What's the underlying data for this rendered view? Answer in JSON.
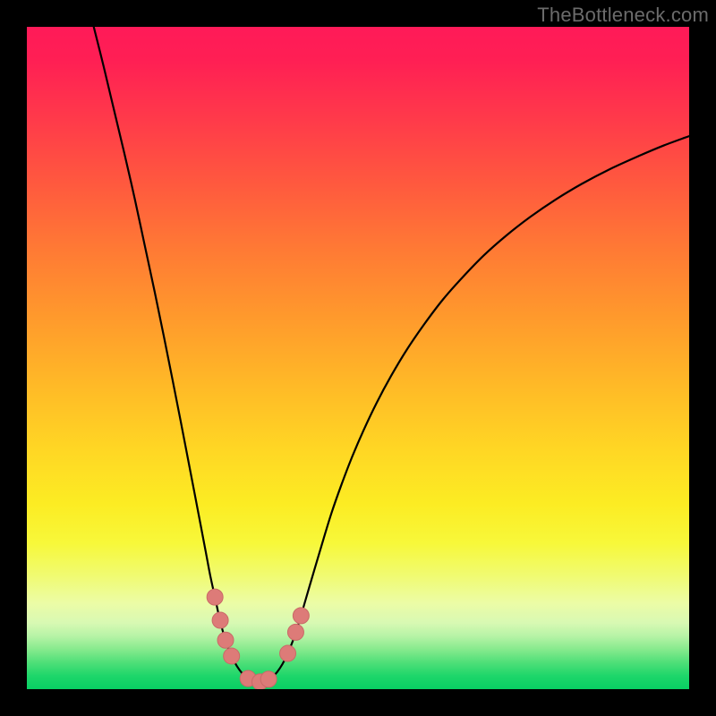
{
  "watermark_text": "TheBottleneck.com",
  "colors": {
    "curve_stroke": "#000000",
    "marker_fill": "#dd7b78",
    "marker_stroke": "#c96a67"
  },
  "chart_data": {
    "type": "line",
    "title": "",
    "xlabel": "",
    "ylabel": "",
    "xlim": [
      0,
      100
    ],
    "ylim": [
      0,
      100
    ],
    "curve": {
      "comment": "V-shaped bottleneck curve. x in percent of plot width, y in percent of plot height (0 = top, 100 = bottom). No numeric axis labels are visible in the image; values are geometric reconstructions of the plotted path.",
      "points": [
        [
          10.1,
          0.0
        ],
        [
          11.6,
          6.0
        ],
        [
          13.1,
          12.3
        ],
        [
          14.7,
          19.0
        ],
        [
          16.3,
          26.0
        ],
        [
          17.8,
          33.0
        ],
        [
          19.3,
          40.0
        ],
        [
          20.7,
          46.8
        ],
        [
          22.0,
          53.3
        ],
        [
          23.2,
          59.4
        ],
        [
          24.3,
          65.1
        ],
        [
          25.3,
          70.3
        ],
        [
          26.2,
          75.0
        ],
        [
          27.0,
          79.2
        ],
        [
          27.7,
          82.9
        ],
        [
          28.4,
          86.1
        ],
        [
          29.0,
          88.9
        ],
        [
          29.6,
          91.3
        ],
        [
          30.2,
          93.3
        ],
        [
          30.9,
          95.0
        ],
        [
          31.7,
          96.5
        ],
        [
          32.5,
          97.6
        ],
        [
          33.4,
          98.4
        ],
        [
          34.3,
          98.8
        ],
        [
          35.2,
          98.9
        ],
        [
          36.1,
          98.7
        ],
        [
          37.0,
          98.2
        ],
        [
          37.8,
          97.4
        ],
        [
          38.6,
          96.2
        ],
        [
          39.4,
          94.6
        ],
        [
          40.2,
          92.6
        ],
        [
          41.0,
          90.2
        ],
        [
          41.8,
          87.5
        ],
        [
          42.7,
          84.4
        ],
        [
          43.7,
          81.0
        ],
        [
          44.8,
          77.3
        ],
        [
          46.0,
          73.4
        ],
        [
          47.4,
          69.4
        ],
        [
          49.0,
          65.2
        ],
        [
          50.8,
          61.0
        ],
        [
          52.8,
          56.8
        ],
        [
          55.0,
          52.7
        ],
        [
          57.4,
          48.7
        ],
        [
          60.0,
          44.9
        ],
        [
          62.8,
          41.2
        ],
        [
          65.8,
          37.8
        ],
        [
          69.0,
          34.5
        ],
        [
          72.4,
          31.5
        ],
        [
          76.0,
          28.7
        ],
        [
          79.8,
          26.1
        ],
        [
          83.8,
          23.7
        ],
        [
          88.0,
          21.5
        ],
        [
          92.4,
          19.5
        ],
        [
          96.2,
          17.9
        ],
        [
          100.0,
          16.5
        ]
      ]
    },
    "markers": {
      "comment": "Pink/salmon dot markers near the valley of the curve. Coordinates in same percent space as curve.",
      "points": [
        [
          28.4,
          86.1
        ],
        [
          29.2,
          89.6
        ],
        [
          30.0,
          92.6
        ],
        [
          30.9,
          95.0
        ],
        [
          33.4,
          98.4
        ],
        [
          35.2,
          98.9
        ],
        [
          36.5,
          98.5
        ],
        [
          39.4,
          94.6
        ],
        [
          40.6,
          91.4
        ],
        [
          41.4,
          88.9
        ]
      ]
    }
  }
}
